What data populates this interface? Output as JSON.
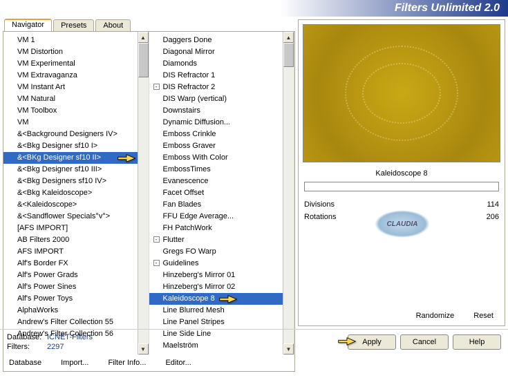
{
  "title": "Filters Unlimited 2.0",
  "tabs": {
    "navigator": "Navigator",
    "presets": "Presets",
    "about": "About"
  },
  "categories": [
    "VM 1",
    "VM Distortion",
    "VM Experimental",
    "VM Extravaganza",
    "VM Instant Art",
    "VM Natural",
    "VM Toolbox",
    "VM",
    "&<Background Designers IV>",
    "&<Bkg Designer sf10 I>",
    "&<BKg Designer sf10 II>",
    "&<Bkg Designer sf10 III>",
    "&<Bkg Designers sf10 IV>",
    "&<Bkg Kaleidoscope>",
    "&<Kaleidoscope>",
    "&<Sandflower Specials°v°>",
    "[AFS IMPORT]",
    "AB Filters 2000",
    "AFS IMPORT",
    "Alf's Border FX",
    "Alf's Power Grads",
    "Alf's Power Sines",
    "Alf's Power Toys",
    "AlphaWorks",
    "Andrew's Filter Collection 55",
    "Andrew's Filter Collection 56"
  ],
  "selected_category_index": 10,
  "filters": [
    {
      "n": "Daggers Done"
    },
    {
      "n": "Diagonal Mirror"
    },
    {
      "n": "Diamonds"
    },
    {
      "n": "DIS Refractor 1"
    },
    {
      "n": "DIS Refractor 2",
      "t": true
    },
    {
      "n": "DIS Warp (vertical)"
    },
    {
      "n": "Downstairs"
    },
    {
      "n": "Dynamic Diffusion..."
    },
    {
      "n": "Emboss Crinkle"
    },
    {
      "n": "Emboss Graver"
    },
    {
      "n": "Emboss With Color"
    },
    {
      "n": "EmbossTimes"
    },
    {
      "n": "Evanescence"
    },
    {
      "n": "Facet Offset"
    },
    {
      "n": "Fan Blades"
    },
    {
      "n": "FFU Edge Average..."
    },
    {
      "n": "FH PatchWork"
    },
    {
      "n": "Flutter",
      "t": true
    },
    {
      "n": "Gregs FO Warp"
    },
    {
      "n": "Guidelines",
      "t": true
    },
    {
      "n": "Hinzeberg's Mirror 01"
    },
    {
      "n": "Hinzeberg's Mirror 02"
    },
    {
      "n": "Kaleidoscope 8"
    },
    {
      "n": "Line Blurred Mesh"
    },
    {
      "n": "Line Panel Stripes"
    },
    {
      "n": "Line Side Line"
    },
    {
      "n": "Maelström"
    }
  ],
  "selected_filter_index": 22,
  "nav_buttons": {
    "database": "Database",
    "import": "Import...",
    "filterinfo": "Filter Info...",
    "editor": "Editor..."
  },
  "preview": {
    "name": "Kaleidoscope 8",
    "sliders": [
      {
        "label": "Divisions",
        "value": "114"
      },
      {
        "label": "Rotations",
        "value": "206"
      }
    ],
    "randomize": "Randomize",
    "reset": "Reset"
  },
  "footer": {
    "database_label": "Database:",
    "database_value": "ICNET-Filters",
    "filters_label": "Filters:",
    "filters_value": "2297",
    "apply": "Apply",
    "cancel": "Cancel",
    "help": "Help"
  },
  "watermark": "CLAUDIA"
}
